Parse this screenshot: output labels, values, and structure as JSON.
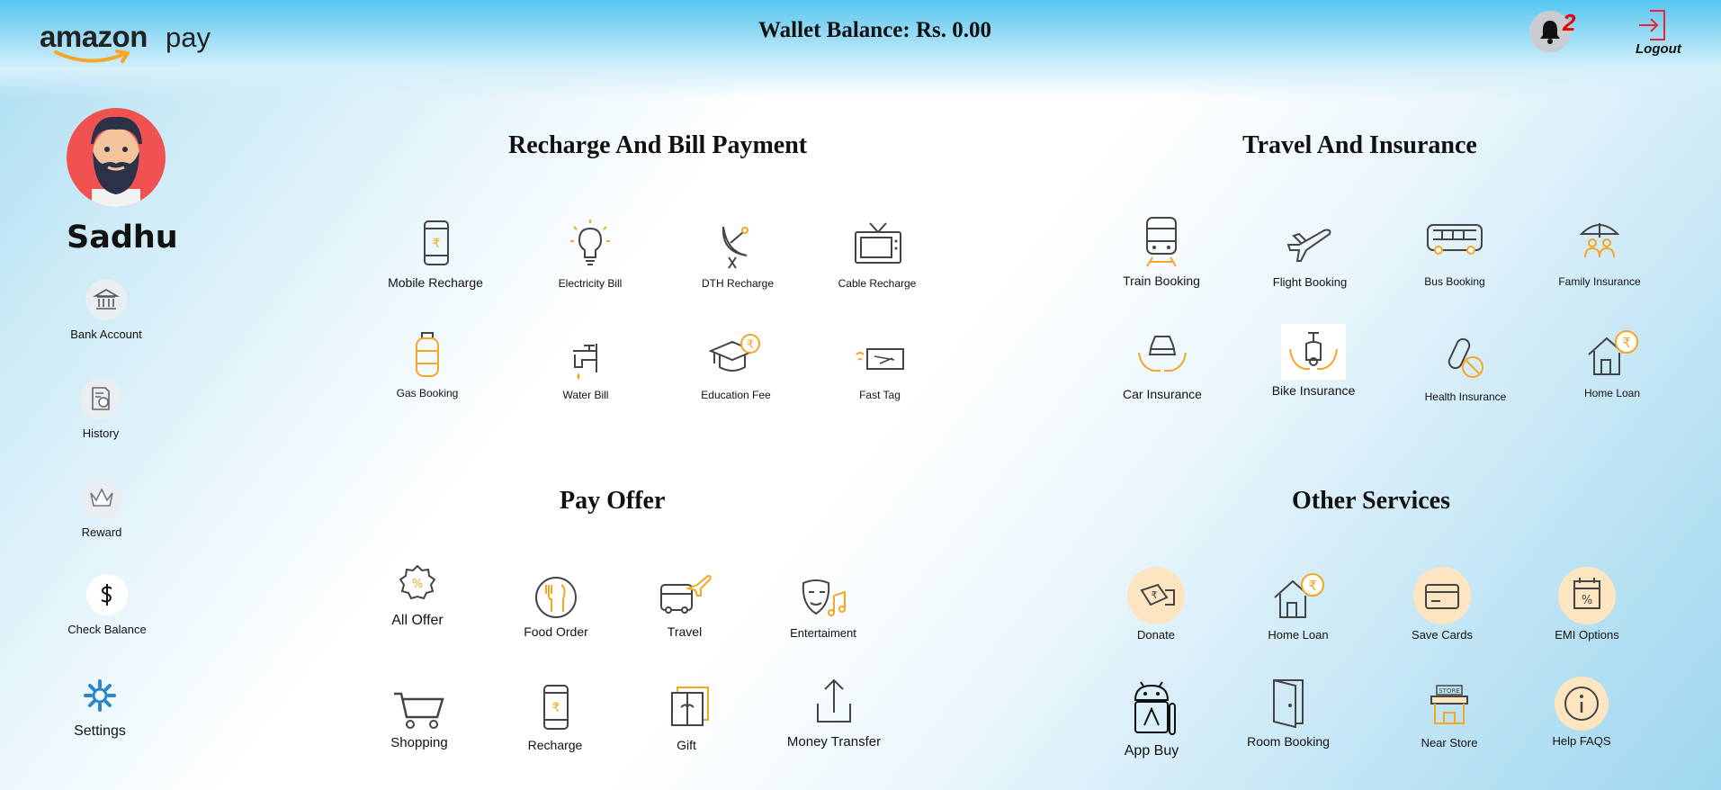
{
  "header": {
    "logo_word": "amazon",
    "logo_pay": "pay",
    "wallet_text": "Wallet Balance: Rs. 0.00",
    "notification_count": "2",
    "logout_label": "Logout"
  },
  "sidebar": {
    "user_name": "Sadhu",
    "items": [
      {
        "label": "Bank Account",
        "icon": "bank-icon"
      },
      {
        "label": "History",
        "icon": "history-icon"
      },
      {
        "label": "Reward",
        "icon": "crown-icon"
      },
      {
        "label": "Check Balance",
        "icon": "dollar-icon"
      },
      {
        "label": "Settings",
        "icon": "gear-icon"
      }
    ]
  },
  "sections": {
    "recharge": {
      "title": "Recharge And Bill Payment",
      "items": [
        "Mobile Recharge",
        "Electricity Bill",
        "DTH Recharge",
        "Cable Recharge",
        "Gas Booking",
        "Water Bill",
        "Education Fee",
        "Fast Tag"
      ]
    },
    "travel": {
      "title": "Travel And Insurance",
      "items": [
        "Train Booking",
        "Flight Booking",
        "Bus Booking",
        "Family Insurance",
        "Car Insurance",
        "Bike Insurance",
        "Health Insurance",
        "Home Loan"
      ]
    },
    "offers": {
      "title": "Pay Offer",
      "items": [
        "All Offer",
        "Food Order",
        "Travel",
        "Entertaiment",
        "Shopping",
        "Recharge",
        "Gift",
        "Money Transfer"
      ]
    },
    "other": {
      "title": "Other Services",
      "items": [
        "Donate",
        "Home Loan",
        "Save Cards",
        "EMI Options",
        "App Buy",
        "Room Booking",
        "Near Store",
        "Help FAQS"
      ]
    }
  },
  "colors": {
    "accent": "#f5a623",
    "icon_stroke": "#444444",
    "header_blue": "#55c6f0",
    "avatar_bg": "#f05252",
    "notification": "#e00000"
  }
}
